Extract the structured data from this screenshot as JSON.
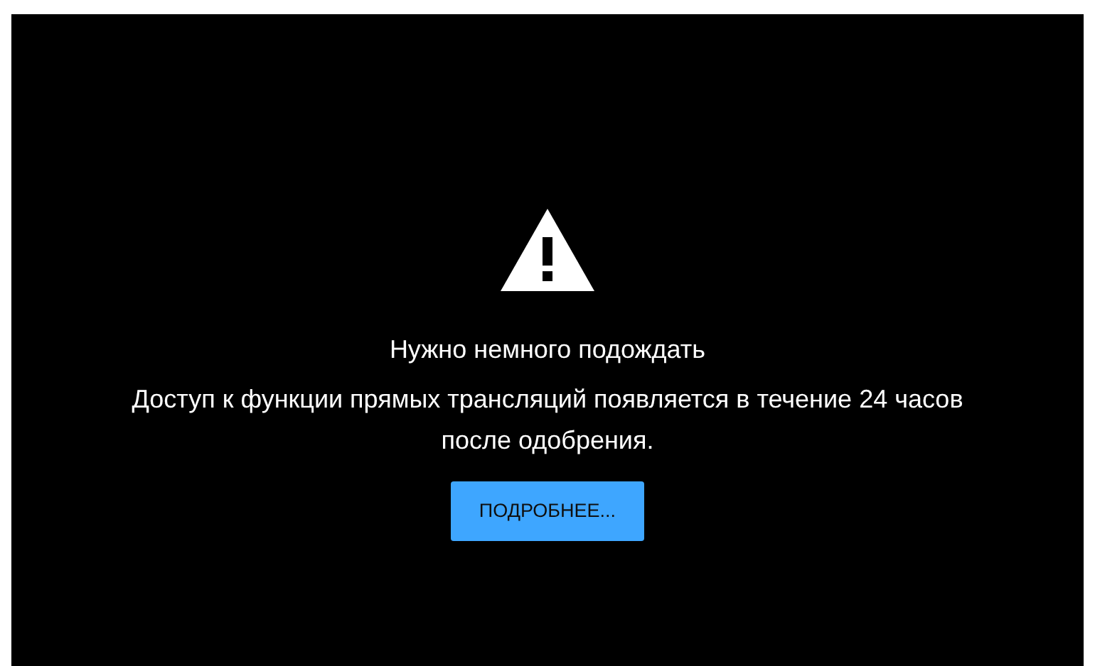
{
  "notice": {
    "title": "Нужно немного подождать",
    "message": "Доступ к функции прямых трансляций появляется в течение 24 часов после одобрения.",
    "button": "ПОДРОБНЕЕ..."
  }
}
